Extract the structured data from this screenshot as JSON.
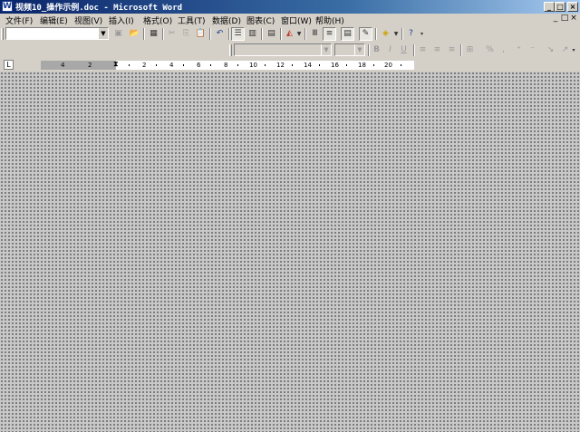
{
  "window": {
    "title": "视频10_操作示例.doc - Microsoft Word",
    "controls": {
      "minimize": "_",
      "maximize": "□",
      "close": "×"
    }
  },
  "menubar": {
    "items": [
      "文件(F)",
      "编辑(E)",
      "视图(V)",
      "插入(I)",
      "格式(O)",
      "工具(T)",
      "数据(D)",
      "图表(C)",
      "窗口(W)",
      "帮助(H)"
    ],
    "doc_controls": {
      "minimize": "_",
      "restore": "□",
      "close": "×"
    }
  },
  "toolbar1": {
    "name_box_value": "",
    "buttons": [
      "import-file-icon",
      "view-datasheet-icon",
      "cut-icon",
      "copy-icon",
      "paste-icon",
      "undo-icon",
      "by-row-icon",
      "by-column-icon",
      "data-table-icon",
      "chart-type-icon",
      "category-axis-gridlines-icon",
      "value-axis-gridlines-icon",
      "legend-icon",
      "drawing-icon",
      "fill-color-icon",
      "help-icon"
    ]
  },
  "toolbar2": {
    "font_name": "",
    "font_size": "",
    "buttons": {
      "bold": "B",
      "italic": "I",
      "underline": "U"
    },
    "other": [
      "align-left-icon",
      "center-icon",
      "align-right-icon",
      "merge-center-icon",
      "currency-icon",
      "percent-icon",
      "comma-icon",
      "increase-decimal-icon",
      "decrease-decimal-icon",
      "angle-clockwise-icon",
      "angle-counterclockwise-icon"
    ]
  },
  "ruler": {
    "tab_selector": "L",
    "left_numbers": [
      "4",
      "2"
    ],
    "numbers": [
      "2",
      "4",
      "6",
      "8",
      "10",
      "12",
      "14",
      "16",
      "18",
      "20"
    ]
  }
}
